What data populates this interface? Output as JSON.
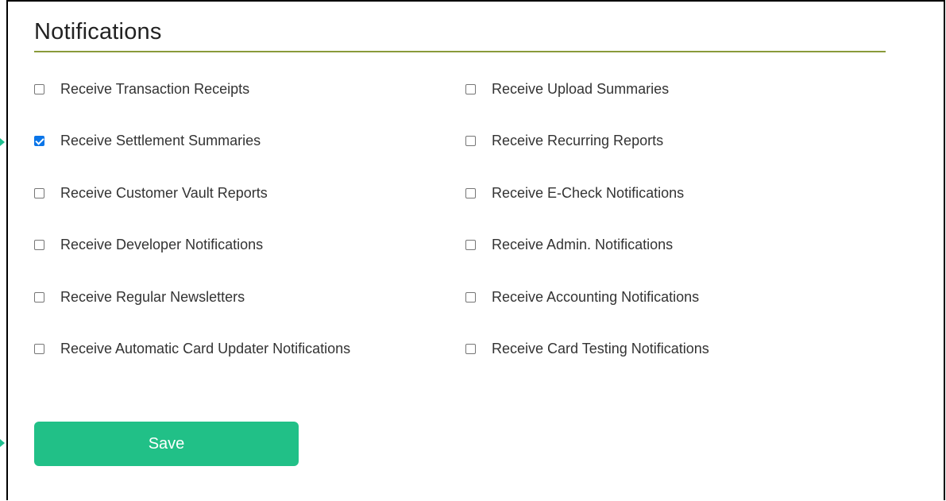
{
  "section": {
    "title": "Notifications"
  },
  "options": [
    {
      "label": "Receive Transaction Receipts",
      "checked": false
    },
    {
      "label": "Receive Upload Summaries",
      "checked": false
    },
    {
      "label": "Receive Settlement Summaries",
      "checked": true
    },
    {
      "label": "Receive Recurring Reports",
      "checked": false
    },
    {
      "label": "Receive Customer Vault Reports",
      "checked": false
    },
    {
      "label": "Receive E-Check Notifications",
      "checked": false
    },
    {
      "label": "Receive Developer Notifications",
      "checked": false
    },
    {
      "label": "Receive Admin. Notifications",
      "checked": false
    },
    {
      "label": "Receive Regular Newsletters",
      "checked": false
    },
    {
      "label": "Receive Accounting Notifications",
      "checked": false
    },
    {
      "label": "Receive Automatic Card Updater Notifications",
      "checked": false
    },
    {
      "label": "Receive Card Testing Notifications",
      "checked": false
    }
  ],
  "actions": {
    "save_label": "Save"
  },
  "colors": {
    "accent": "#21c087",
    "checkbox_checked": "#0a75e8",
    "title_rule": "#8a9a3a"
  }
}
